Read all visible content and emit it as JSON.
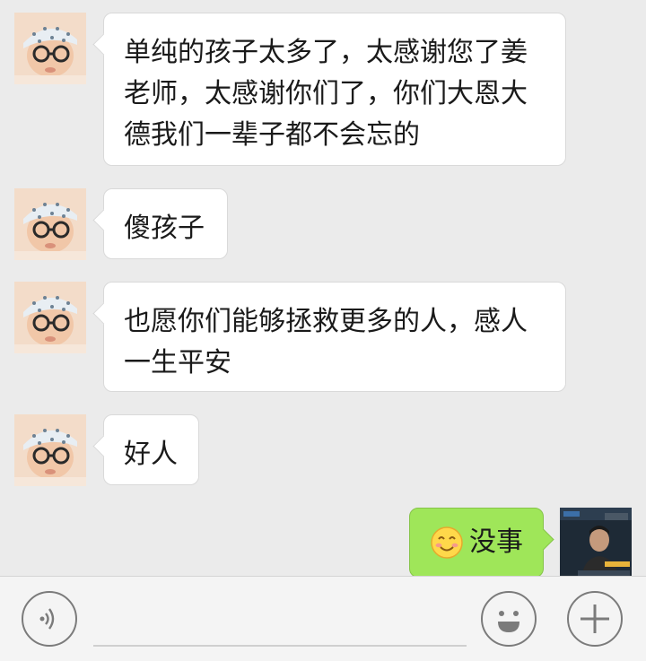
{
  "messages": [
    {
      "sender": "other",
      "text": "单纯的孩子太多了，太感谢您了姜老师，太感谢你们了，你们大恩大德我们一辈子都不会忘的"
    },
    {
      "sender": "other",
      "text": "傻孩子"
    },
    {
      "sender": "other",
      "text": "也愿你们能够拯救更多的人，感人一生平安"
    },
    {
      "sender": "other",
      "text": "好人"
    },
    {
      "sender": "self",
      "emoji": "smiling-face",
      "text": "没事"
    }
  ],
  "input_bar": {
    "voice_icon": "voice-icon",
    "emoji_icon": "emoji-face-icon",
    "more_icon": "plus-icon"
  },
  "colors": {
    "background": "#ebebeb",
    "incoming_bubble": "#ffffff",
    "outgoing_bubble": "#9fe659",
    "input_bar": "#f4f4f4"
  }
}
